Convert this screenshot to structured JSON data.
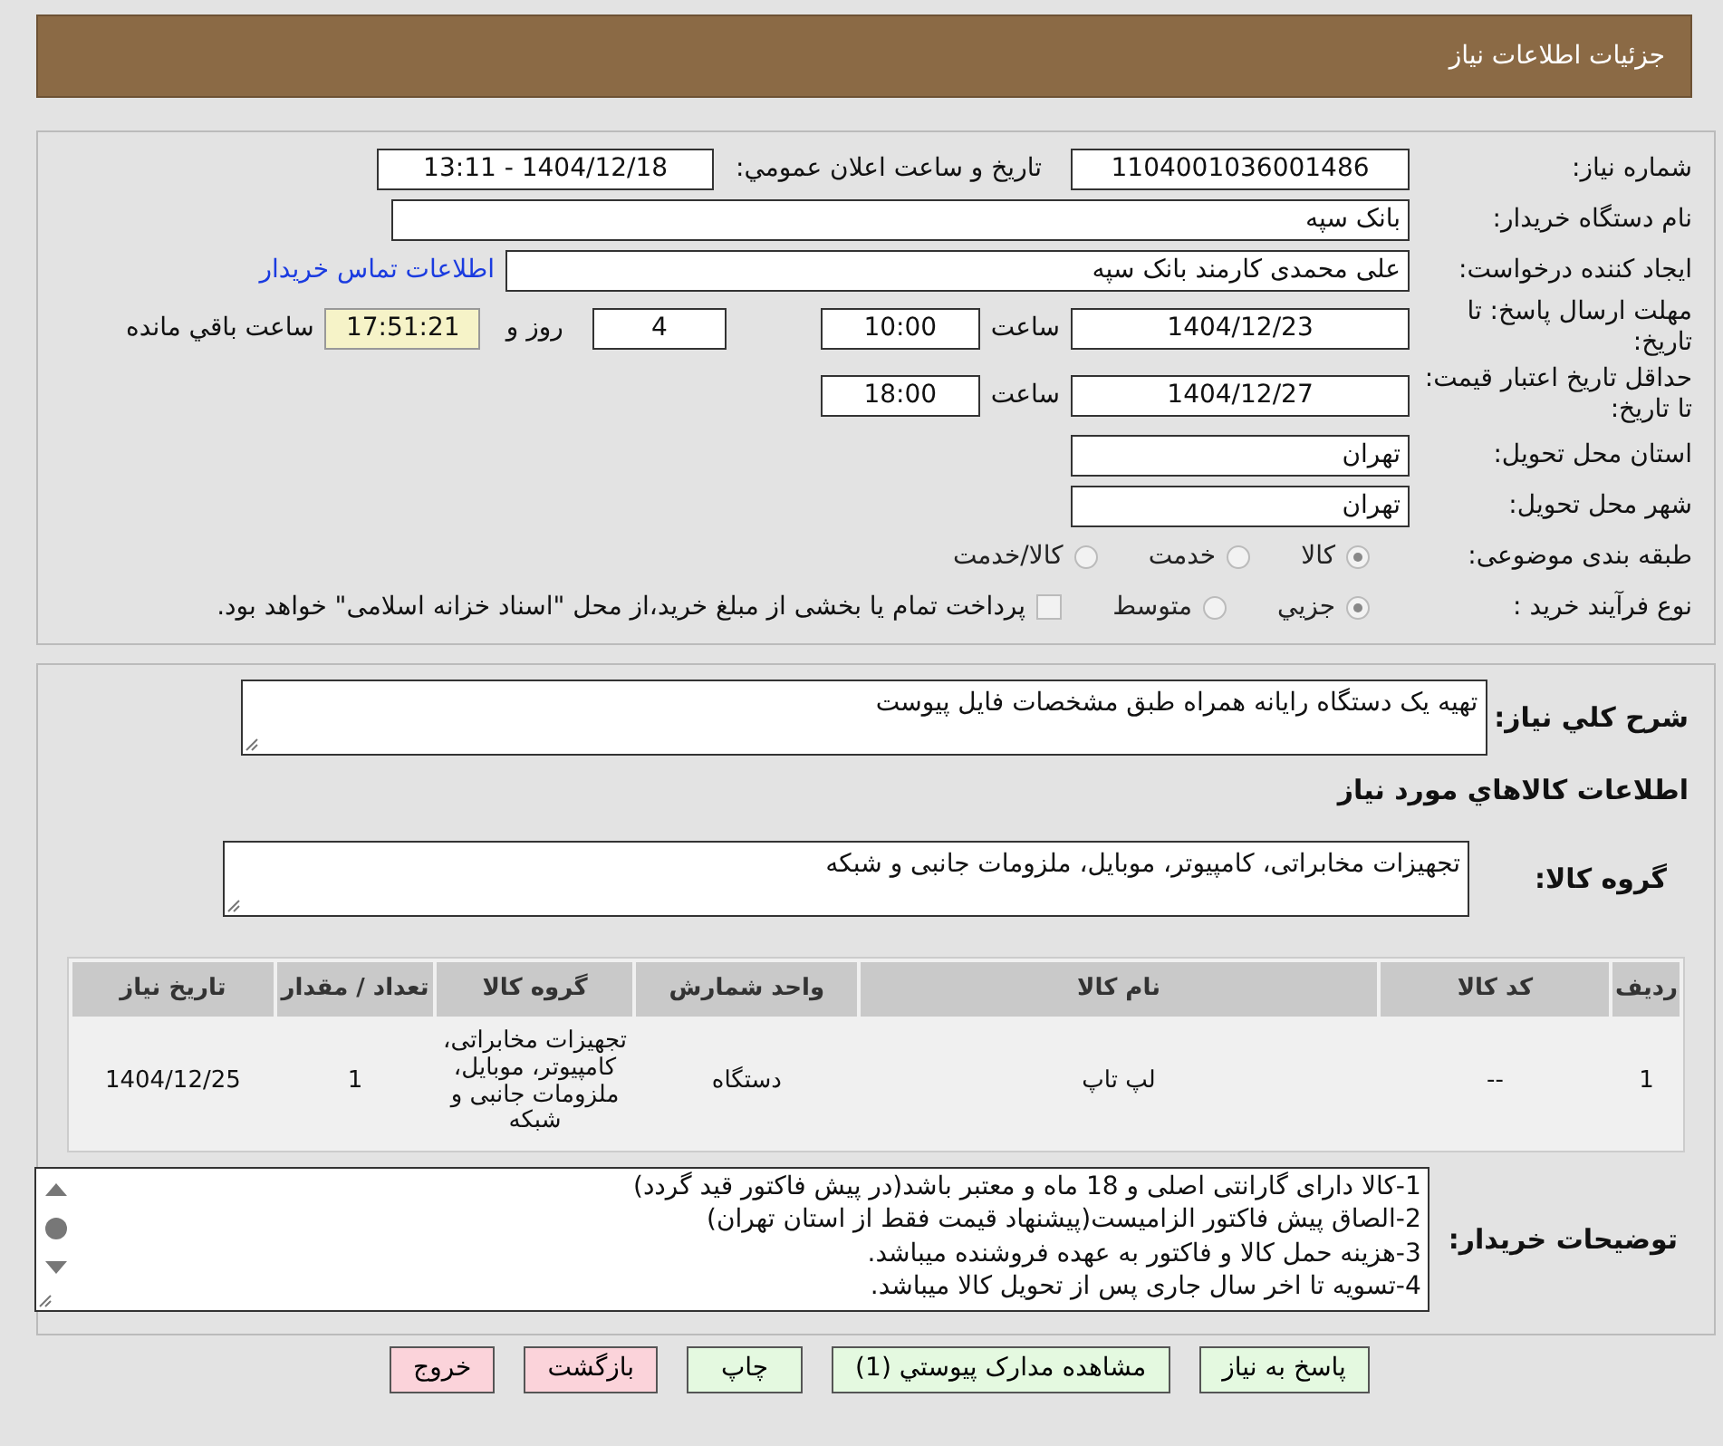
{
  "header": {
    "title": "جزئیات اطلاعات نیاز"
  },
  "form": {
    "need_number": {
      "label": "شماره نیاز:",
      "value": "1104001036001486"
    },
    "announce": {
      "label": "تاریخ و ساعت اعلان عمومي:",
      "value": "1404/12/18 - 13:11"
    },
    "buyer_org": {
      "label": "نام دستگاه خریدار:",
      "value": "بانک سپه"
    },
    "creator": {
      "label": "ایجاد کننده درخواست:",
      "value": "علی محمدی کارمند بانک سپه",
      "link": "اطلاعات تماس خریدار"
    },
    "deadline": {
      "label": "مهلت ارسال پاسخ: تا تاریخ:",
      "date": "1404/12/23",
      "time_label": "ساعت",
      "time": "10:00",
      "days": "4",
      "days_label": "روز و",
      "countdown": "17:51:21",
      "remaining_label": "ساعت باقي مانده"
    },
    "validity": {
      "label": "حداقل تاریخ اعتبار قیمت: تا تاریخ:",
      "date": "1404/12/27",
      "time_label": "ساعت",
      "time": "18:00"
    },
    "province": {
      "label": "استان محل تحویل:",
      "value": "تهران"
    },
    "city": {
      "label": "شهر محل تحویل:",
      "value": "تهران"
    },
    "category": {
      "label": "طبقه بندی موضوعی:",
      "options": [
        {
          "label": "کالا",
          "selected": true
        },
        {
          "label": "خدمت",
          "selected": false
        },
        {
          "label": "کالا/خدمت",
          "selected": false
        }
      ]
    },
    "purchase_type": {
      "label": "نوع فرآیند خرید :",
      "options": [
        {
          "label": "جزیي",
          "selected": true
        },
        {
          "label": "متوسط",
          "selected": false
        }
      ],
      "payment": {
        "label": "پرداخت تمام یا بخشی از مبلغ خرید،از محل \"اسناد خزانه اسلامی\" خواهد بود.",
        "checked": false
      }
    }
  },
  "details": {
    "description": {
      "label": "شرح كلي نیاز:",
      "value": "تهیه یک دستگاه رایانه همراه طبق مشخصات فایل پیوست"
    },
    "goods_heading": "اطلاعات كالاهاي مورد نياز",
    "goods_group": {
      "label": "گروه کالا:",
      "value": "تجهیزات مخابراتی، کامپیوتر، موبایل، ملزومات جانبی و شبکه"
    },
    "table": {
      "columns": [
        "ردیف",
        "کد کالا",
        "نام کالا",
        "واحد شمارش",
        "گروه کالا",
        "تعداد / مقدار",
        "تاریخ نیاز"
      ],
      "rows": [
        [
          "1",
          "--",
          "لپ تاپ",
          "دستگاه",
          "تجهیزات مخابراتی، کامپیوتر، موبایل، ملزومات جانبی و شبکه",
          "1",
          "1404/12/25"
        ]
      ]
    },
    "notes": {
      "label": "توضیحات خریدار:",
      "lines": [
        "1-کالا دارای گارانتی اصلی و  18 ماه و معتبر باشد(در پیش فاکتور قید گردد)",
        "2-الصاق پیش فاکتور الزامیست(پیشنهاد قیمت فقط از استان تهران)",
        "3-هزینه حمل کالا و فاکتور به عهده فروشنده میباشد.",
        "4-تسویه تا اخر سال جاری پس از تحویل کالا میباشد."
      ]
    }
  },
  "buttons": [
    {
      "label": "پاسخ به نیاز",
      "kind": "go"
    },
    {
      "label": "مشاهده مدارک پیوستي (1)",
      "kind": "go"
    },
    {
      "label": "چاپ",
      "kind": "go"
    },
    {
      "label": "بازگشت",
      "kind": "stop"
    },
    {
      "label": "خروج",
      "kind": "stop"
    }
  ]
}
